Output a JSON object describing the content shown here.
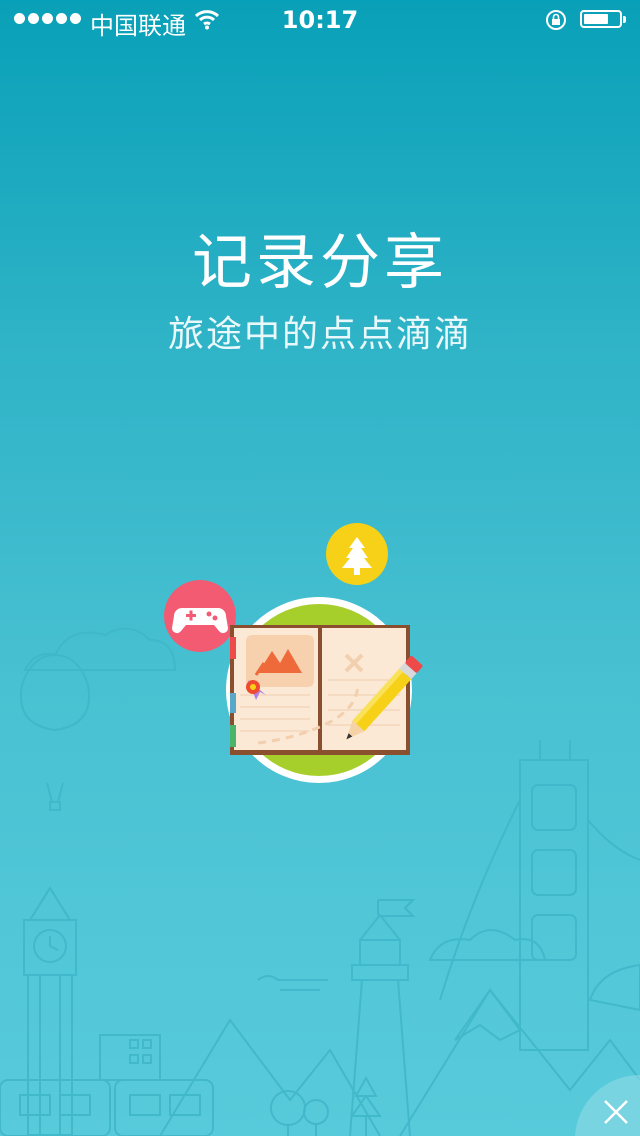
{
  "status_bar": {
    "carrier": "中国联通",
    "time": "10:17",
    "battery_level": 0.72
  },
  "page": {
    "title": "记录分享",
    "subtitle": "旅途中的点点滴滴"
  },
  "icons": {
    "game": "gamepad-icon",
    "tree": "tree-icon",
    "close": "close-icon"
  },
  "colors": {
    "game_circle": "#f25b72",
    "tree_circle": "#f7d117",
    "illustration_ground": "#a7cf2b"
  }
}
